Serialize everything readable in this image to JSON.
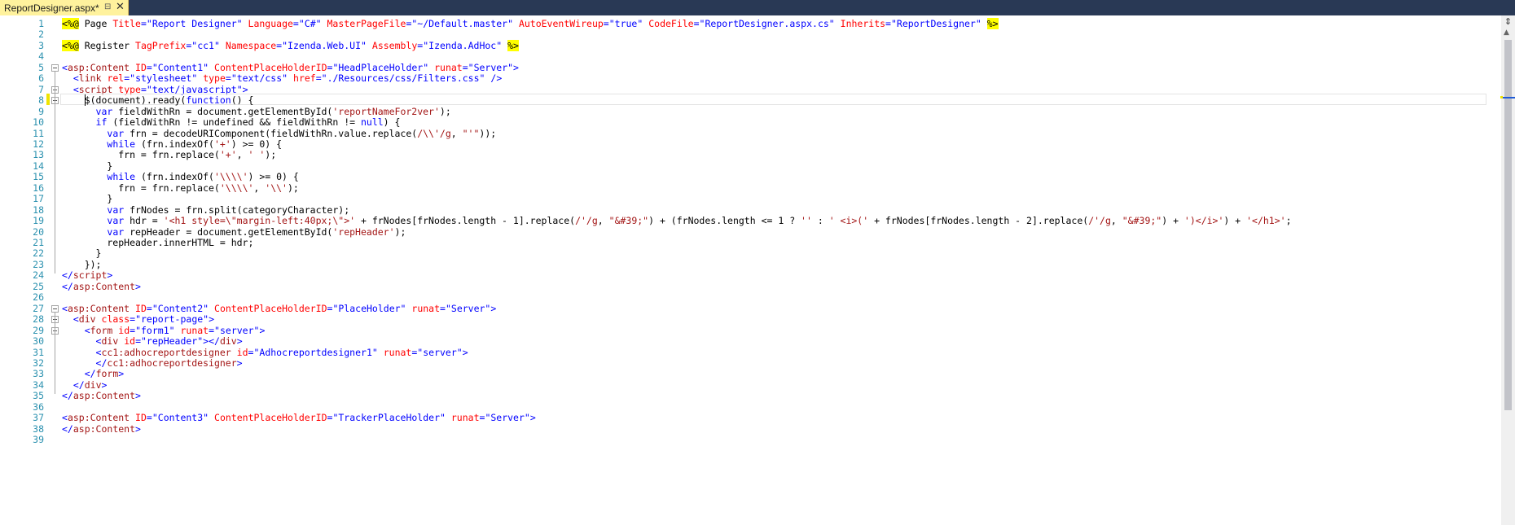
{
  "document_tab": {
    "title": "ReportDesigner.aspx*",
    "pin_icon": "pin-icon",
    "close_icon": "close-icon",
    "close_glyph": "✕",
    "pin_glyph": "⊟"
  },
  "scrollbar": {
    "split_glyph": "⇕",
    "up_glyph": "▲"
  },
  "colors": {
    "tab_active": "#fff29d",
    "tab_strip": "#293955",
    "line_number": "#2b91af",
    "markup_tag": "#a31515",
    "attribute": "#ff0000",
    "keyword": "#0000ff",
    "server_delimiter": "#ffff00"
  },
  "editor": {
    "lines": [
      [
        [
          "delim",
          "<%@"
        ],
        [
          "aspx",
          " Page "
        ],
        [
          "attr",
          "Title"
        ],
        [
          "bracket",
          "="
        ],
        [
          "val",
          "\"Report Designer\""
        ],
        [
          "aspx",
          " "
        ],
        [
          "attr",
          "Language"
        ],
        [
          "bracket",
          "="
        ],
        [
          "val",
          "\"C#\""
        ],
        [
          "aspx",
          " "
        ],
        [
          "attr",
          "MasterPageFile"
        ],
        [
          "bracket",
          "="
        ],
        [
          "val",
          "\"~/Default.master\""
        ],
        [
          "aspx",
          " "
        ],
        [
          "attr",
          "AutoEventWireup"
        ],
        [
          "bracket",
          "="
        ],
        [
          "val",
          "\"true\""
        ],
        [
          "aspx",
          " "
        ],
        [
          "attr",
          "CodeFile"
        ],
        [
          "bracket",
          "="
        ],
        [
          "val",
          "\"ReportDesigner.aspx.cs\""
        ],
        [
          "aspx",
          " "
        ],
        [
          "attr",
          "Inherits"
        ],
        [
          "bracket",
          "="
        ],
        [
          "val",
          "\"ReportDesigner\""
        ],
        [
          "aspx",
          " "
        ],
        [
          "delim",
          "%>"
        ]
      ],
      [],
      [
        [
          "delim",
          "<%@"
        ],
        [
          "aspx",
          " Register "
        ],
        [
          "attr",
          "TagPrefix"
        ],
        [
          "bracket",
          "="
        ],
        [
          "val",
          "\"cc1\""
        ],
        [
          "aspx",
          " "
        ],
        [
          "attr",
          "Namespace"
        ],
        [
          "bracket",
          "="
        ],
        [
          "val",
          "\"Izenda.Web.UI\""
        ],
        [
          "aspx",
          " "
        ],
        [
          "attr",
          "Assembly"
        ],
        [
          "bracket",
          "="
        ],
        [
          "val",
          "\"Izenda.AdHoc\""
        ],
        [
          "aspx",
          " "
        ],
        [
          "delim",
          "%>"
        ]
      ],
      [],
      [
        [
          "bracket",
          "<"
        ],
        [
          "tag",
          "asp:Content"
        ],
        [
          "plain",
          " "
        ],
        [
          "attr",
          "ID"
        ],
        [
          "bracket",
          "="
        ],
        [
          "val",
          "\"Content1\""
        ],
        [
          "plain",
          " "
        ],
        [
          "attr",
          "ContentPlaceHolderID"
        ],
        [
          "bracket",
          "="
        ],
        [
          "val",
          "\"HeadPlaceHolder\""
        ],
        [
          "plain",
          " "
        ],
        [
          "attr",
          "runat"
        ],
        [
          "bracket",
          "="
        ],
        [
          "val",
          "\"Server\""
        ],
        [
          "bracket",
          ">"
        ]
      ],
      [
        [
          "plain",
          "  "
        ],
        [
          "bracket",
          "<"
        ],
        [
          "tag",
          "link"
        ],
        [
          "plain",
          " "
        ],
        [
          "attr",
          "rel"
        ],
        [
          "bracket",
          "="
        ],
        [
          "val",
          "\"stylesheet\""
        ],
        [
          "plain",
          " "
        ],
        [
          "attr",
          "type"
        ],
        [
          "bracket",
          "="
        ],
        [
          "val",
          "\"text/css\""
        ],
        [
          "plain",
          " "
        ],
        [
          "attr",
          "href"
        ],
        [
          "bracket",
          "="
        ],
        [
          "val",
          "\"./Resources/css/Filters.css\""
        ],
        [
          "plain",
          " "
        ],
        [
          "bracket",
          "/>"
        ]
      ],
      [
        [
          "plain",
          "  "
        ],
        [
          "bracket",
          "<"
        ],
        [
          "tag",
          "script"
        ],
        [
          "plain",
          " "
        ],
        [
          "attr",
          "type"
        ],
        [
          "bracket",
          "="
        ],
        [
          "val",
          "\"text/javascript\""
        ],
        [
          "bracket",
          ">"
        ]
      ],
      [
        [
          "plain",
          "    $(document).ready("
        ],
        [
          "kw",
          "function"
        ],
        [
          "plain",
          "() {"
        ]
      ],
      [
        [
          "plain",
          "      "
        ],
        [
          "kw",
          "var"
        ],
        [
          "plain",
          " fieldWithRn = document.getElementById("
        ],
        [
          "str",
          "'reportNameFor2ver'"
        ],
        [
          "plain",
          ");"
        ]
      ],
      [
        [
          "plain",
          "      "
        ],
        [
          "kw",
          "if"
        ],
        [
          "plain",
          " (fieldWithRn != undefined && fieldWithRn != "
        ],
        [
          "kw",
          "null"
        ],
        [
          "plain",
          ") {"
        ]
      ],
      [
        [
          "plain",
          "        "
        ],
        [
          "kw",
          "var"
        ],
        [
          "plain",
          " frn = decodeURIComponent(fieldWithRn.value.replace("
        ],
        [
          "str",
          "/\\\\'/g"
        ],
        [
          "plain",
          ", "
        ],
        [
          "str",
          "\"'\""
        ],
        [
          "plain",
          "));"
        ]
      ],
      [
        [
          "plain",
          "        "
        ],
        [
          "kw",
          "while"
        ],
        [
          "plain",
          " (frn.indexOf("
        ],
        [
          "str",
          "'+'"
        ],
        [
          "plain",
          ") >= 0) {"
        ]
      ],
      [
        [
          "plain",
          "          frn = frn.replace("
        ],
        [
          "str",
          "'+'"
        ],
        [
          "plain",
          ", "
        ],
        [
          "str",
          "' '"
        ],
        [
          "plain",
          ");"
        ]
      ],
      [
        [
          "plain",
          "        }"
        ]
      ],
      [
        [
          "plain",
          "        "
        ],
        [
          "kw",
          "while"
        ],
        [
          "plain",
          " (frn.indexOf("
        ],
        [
          "str",
          "'\\\\\\\\'"
        ],
        [
          "plain",
          ") >= 0) {"
        ]
      ],
      [
        [
          "plain",
          "          frn = frn.replace("
        ],
        [
          "str",
          "'\\\\\\\\'"
        ],
        [
          "plain",
          ", "
        ],
        [
          "str",
          "'\\\\'"
        ],
        [
          "plain",
          ");"
        ]
      ],
      [
        [
          "plain",
          "        }"
        ]
      ],
      [
        [
          "plain",
          "        "
        ],
        [
          "kw",
          "var"
        ],
        [
          "plain",
          " frNodes = frn.split(categoryCharacter);"
        ]
      ],
      [
        [
          "plain",
          "        "
        ],
        [
          "kw",
          "var"
        ],
        [
          "plain",
          " hdr = "
        ],
        [
          "str",
          "'<h1 style=\\\"margin-left:40px;\\\">'"
        ],
        [
          "plain",
          " + frNodes[frNodes.length - 1].replace("
        ],
        [
          "str",
          "/'/g"
        ],
        [
          "plain",
          ", "
        ],
        [
          "str",
          "\"&#39;\""
        ],
        [
          "plain",
          ") + (frNodes.length <= 1 ? "
        ],
        [
          "str",
          "''"
        ],
        [
          "plain",
          " : "
        ],
        [
          "str",
          "' <i>('"
        ],
        [
          "plain",
          " + frNodes[frNodes.length - 2].replace("
        ],
        [
          "str",
          "/'/g"
        ],
        [
          "plain",
          ", "
        ],
        [
          "str",
          "\"&#39;\""
        ],
        [
          "plain",
          ") + "
        ],
        [
          "str",
          "')</i>'"
        ],
        [
          "plain",
          ") + "
        ],
        [
          "str",
          "'</h1>'"
        ],
        [
          "plain",
          ";"
        ]
      ],
      [
        [
          "plain",
          "        "
        ],
        [
          "kw",
          "var"
        ],
        [
          "plain",
          " repHeader = document.getElementById("
        ],
        [
          "str",
          "'repHeader'"
        ],
        [
          "plain",
          ");"
        ]
      ],
      [
        [
          "plain",
          "        repHeader.innerHTML = hdr;"
        ]
      ],
      [
        [
          "plain",
          "      }"
        ]
      ],
      [
        [
          "plain",
          "    });"
        ]
      ],
      [
        [
          "bracket",
          "</"
        ],
        [
          "tag",
          "script"
        ],
        [
          "bracket",
          ">"
        ]
      ],
      [
        [
          "bracket",
          "</"
        ],
        [
          "tag",
          "asp:Content"
        ],
        [
          "bracket",
          ">"
        ]
      ],
      [],
      [
        [
          "bracket",
          "<"
        ],
        [
          "tag",
          "asp:Content"
        ],
        [
          "plain",
          " "
        ],
        [
          "attr",
          "ID"
        ],
        [
          "bracket",
          "="
        ],
        [
          "val",
          "\"Content2\""
        ],
        [
          "plain",
          " "
        ],
        [
          "attr",
          "ContentPlaceHolderID"
        ],
        [
          "bracket",
          "="
        ],
        [
          "val",
          "\"PlaceHolder\""
        ],
        [
          "plain",
          " "
        ],
        [
          "attr",
          "runat"
        ],
        [
          "bracket",
          "="
        ],
        [
          "val",
          "\"Server\""
        ],
        [
          "bracket",
          ">"
        ]
      ],
      [
        [
          "plain",
          "  "
        ],
        [
          "bracket",
          "<"
        ],
        [
          "tag",
          "div"
        ],
        [
          "plain",
          " "
        ],
        [
          "attr",
          "class"
        ],
        [
          "bracket",
          "="
        ],
        [
          "val",
          "\"report-page\""
        ],
        [
          "bracket",
          ">"
        ]
      ],
      [
        [
          "plain",
          "    "
        ],
        [
          "bracket",
          "<"
        ],
        [
          "tag",
          "form"
        ],
        [
          "plain",
          " "
        ],
        [
          "attr",
          "id"
        ],
        [
          "bracket",
          "="
        ],
        [
          "val",
          "\"form1\""
        ],
        [
          "plain",
          " "
        ],
        [
          "attr",
          "runat"
        ],
        [
          "bracket",
          "="
        ],
        [
          "val",
          "\"server\""
        ],
        [
          "bracket",
          ">"
        ]
      ],
      [
        [
          "plain",
          "      "
        ],
        [
          "bracket",
          "<"
        ],
        [
          "tag",
          "div"
        ],
        [
          "plain",
          " "
        ],
        [
          "attr",
          "id"
        ],
        [
          "bracket",
          "="
        ],
        [
          "val",
          "\"repHeader\""
        ],
        [
          "bracket",
          "></"
        ],
        [
          "tag",
          "div"
        ],
        [
          "bracket",
          ">"
        ]
      ],
      [
        [
          "plain",
          "      "
        ],
        [
          "bracket",
          "<"
        ],
        [
          "tag",
          "cc1:adhocreportdesigner"
        ],
        [
          "plain",
          " "
        ],
        [
          "attr",
          "id"
        ],
        [
          "bracket",
          "="
        ],
        [
          "val",
          "\"Adhocreportdesigner1\""
        ],
        [
          "plain",
          " "
        ],
        [
          "attr",
          "runat"
        ],
        [
          "bracket",
          "="
        ],
        [
          "val",
          "\"server\""
        ],
        [
          "bracket",
          ">"
        ]
      ],
      [
        [
          "plain",
          "      "
        ],
        [
          "bracket",
          "</"
        ],
        [
          "tag",
          "cc1:adhocreportdesigner"
        ],
        [
          "bracket",
          ">"
        ]
      ],
      [
        [
          "plain",
          "    "
        ],
        [
          "bracket",
          "</"
        ],
        [
          "tag",
          "form"
        ],
        [
          "bracket",
          ">"
        ]
      ],
      [
        [
          "plain",
          "  "
        ],
        [
          "bracket",
          "</"
        ],
        [
          "tag",
          "div"
        ],
        [
          "bracket",
          ">"
        ]
      ],
      [
        [
          "bracket",
          "</"
        ],
        [
          "tag",
          "asp:Content"
        ],
        [
          "bracket",
          ">"
        ]
      ],
      [],
      [
        [
          "bracket",
          "<"
        ],
        [
          "tag",
          "asp:Content"
        ],
        [
          "plain",
          " "
        ],
        [
          "attr",
          "ID"
        ],
        [
          "bracket",
          "="
        ],
        [
          "val",
          "\"Content3\""
        ],
        [
          "plain",
          " "
        ],
        [
          "attr",
          "ContentPlaceHolderID"
        ],
        [
          "bracket",
          "="
        ],
        [
          "val",
          "\"TrackerPlaceHolder\""
        ],
        [
          "plain",
          " "
        ],
        [
          "attr",
          "runat"
        ],
        [
          "bracket",
          "="
        ],
        [
          "val",
          "\"Server\""
        ],
        [
          "bracket",
          ">"
        ]
      ],
      [
        [
          "bracket",
          "</"
        ],
        [
          "tag",
          "asp:Content"
        ],
        [
          "bracket",
          ">"
        ]
      ],
      []
    ],
    "line_numbers": [
      "1",
      "2",
      "3",
      "4",
      "5",
      "6",
      "7",
      "8",
      "9",
      "10",
      "11",
      "12",
      "13",
      "14",
      "15",
      "16",
      "17",
      "18",
      "19",
      "20",
      "21",
      "22",
      "23",
      "24",
      "25",
      "26",
      "27",
      "28",
      "29",
      "30",
      "31",
      "32",
      "33",
      "34",
      "35",
      "36",
      "37",
      "38",
      "39"
    ],
    "fold_markers": [
      "5",
      "7",
      "8",
      "27",
      "28",
      "29"
    ],
    "modified_line": "8",
    "current_line": "8"
  }
}
